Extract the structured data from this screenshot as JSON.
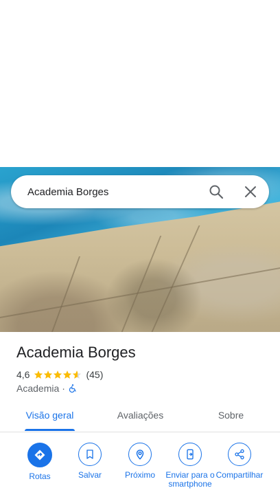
{
  "search": {
    "query": "Academia Borges"
  },
  "place": {
    "name": "Academia Borges",
    "rating": "4,6",
    "rating_value": 4.6,
    "reviews_count": "(45)",
    "category": "Academia",
    "separator": "·",
    "wheelchair_accessible": true
  },
  "tabs": [
    {
      "label": "Visão geral",
      "active": true
    },
    {
      "label": "Avaliações",
      "active": false
    },
    {
      "label": "Sobre",
      "active": false
    }
  ],
  "actions": [
    {
      "label": "Rotas",
      "icon": "directions-icon"
    },
    {
      "label": "Salvar",
      "icon": "bookmark-icon"
    },
    {
      "label": "Próximo",
      "icon": "nearby-icon"
    },
    {
      "label": "Enviar para o smartphone",
      "icon": "send-to-phone-icon"
    },
    {
      "label": "Compartilhar",
      "icon": "share-icon"
    }
  ],
  "colors": {
    "accent": "#1a73e8",
    "star": "#fbbc04",
    "text": "#202124",
    "secondary": "#5f6368"
  }
}
